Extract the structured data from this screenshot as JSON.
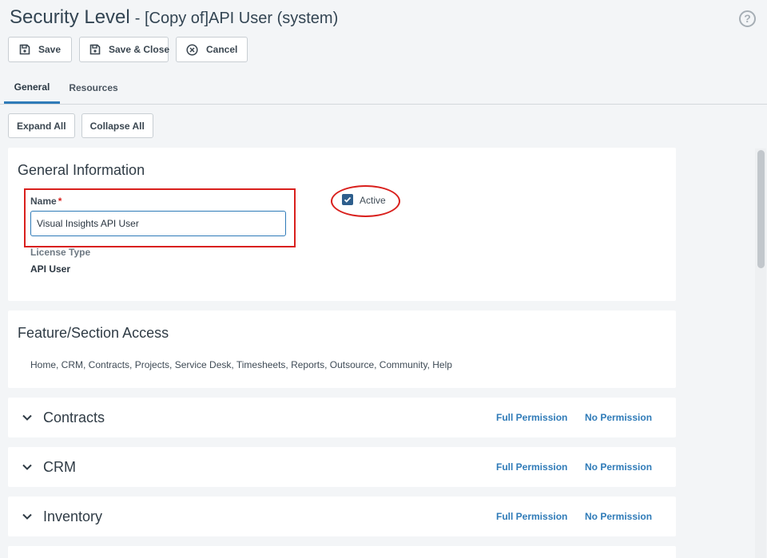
{
  "page": {
    "title": "Security Level",
    "subtitle": "- [Copy of]API User (system)"
  },
  "toolbar": {
    "save_label": "Save",
    "save_close_label": "Save & Close",
    "cancel_label": "Cancel"
  },
  "tabs": [
    {
      "label": "General",
      "active": true
    },
    {
      "label": "Resources",
      "active": false
    }
  ],
  "sub_toolbar": {
    "expand_all_label": "Expand All",
    "collapse_all_label": "Collapse All"
  },
  "general_info": {
    "title": "General Information",
    "name_label": "Name",
    "required_marker": "*",
    "name_value": "Visual Insights API User",
    "active_label": "Active",
    "active_checked": true,
    "license_type_label": "License Type",
    "license_type_value": "API User"
  },
  "feature_access": {
    "title": "Feature/Section Access",
    "value": "Home, CRM, Contracts, Projects, Service Desk, Timesheets, Reports, Outsource, Community, Help"
  },
  "sections": [
    {
      "title": "Contracts",
      "full_label": "Full Permission",
      "none_label": "No Permission"
    },
    {
      "title": "CRM",
      "full_label": "Full Permission",
      "none_label": "No Permission"
    },
    {
      "title": "Inventory",
      "full_label": "Full Permission",
      "none_label": "No Permission"
    }
  ],
  "colors": {
    "accent": "#2f7bb8",
    "highlight_red": "#d9201d",
    "checkbox": "#2e5e8c",
    "background": "#f3f5f7"
  },
  "icons": {
    "help": "help-circle-icon",
    "save": "floppy-disk-icon",
    "save_close": "floppy-disk-icon",
    "cancel": "close-circle-icon",
    "chevron": "chevron-down-icon"
  }
}
